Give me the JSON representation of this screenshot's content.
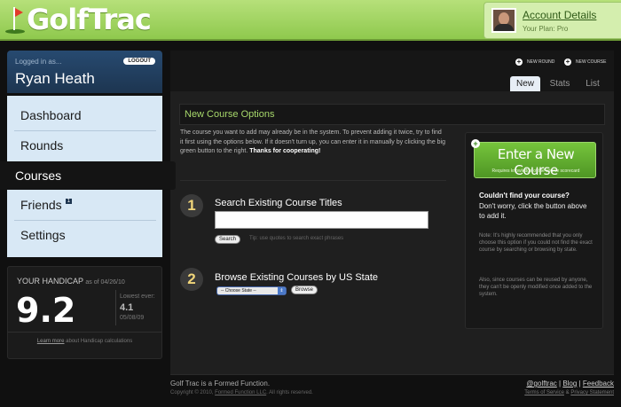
{
  "header": {
    "logo_text": "GolfTrac",
    "account_title": "Account Details",
    "plan": "Your Plan: Pro"
  },
  "user": {
    "logged_in_label": "Logged in as...",
    "logout_label": "LOGOUT",
    "name": "Ryan Heath"
  },
  "nav": {
    "items": [
      {
        "label": "Dashboard"
      },
      {
        "label": "Rounds"
      },
      {
        "label": "Courses"
      },
      {
        "label": "Friends",
        "badge": "1"
      },
      {
        "label": "Settings"
      }
    ]
  },
  "handicap": {
    "label": "YOUR HANDICAP",
    "as_of": "as of 04/26/10",
    "value": "9.2",
    "lowest_label": "Lowest ever:",
    "lowest_value": "4.1",
    "lowest_date": "05/08/09",
    "learn_link": "Learn more",
    "learn_rest": " about Handicap calculations"
  },
  "actions": {
    "new_round": "NEW ROUND",
    "new_course": "NEW COURSE"
  },
  "tabs": [
    {
      "label": "New",
      "active": true
    },
    {
      "label": "Stats"
    },
    {
      "label": "List"
    }
  ],
  "main": {
    "section_title": "New Course Options",
    "intro": "The course you want to add may already be in the system. To prevent adding it twice, try to find it first using the options below. If it doesn't turn up, you can enter it in manually by clicking the big green button to the right.",
    "intro_bold": "Thanks for cooperating!",
    "step1_num": "1",
    "step1_title": "Search Existing Course Titles",
    "search_value": "",
    "search_button": "Search",
    "tip": "Tip: use quotes to search exact phrases",
    "step2_num": "2",
    "step2_title": "Browse Existing Courses by US State",
    "state_selected": "-- Choose State --",
    "browse_button": "Browse"
  },
  "right_panel": {
    "button_title": "Enter a New Course",
    "button_sub": "Requires knowledge of the course scorecard",
    "question": "Couldn't find your course?",
    "answer": "Don't worry, click the button above to add it.",
    "note1": "Note: It's highly recommended that you only choose this option if you could not find the exact course by searching or browsing by state.",
    "note2": "Also, since courses can be reused by anyone, they can't be openly modified once added to the system."
  },
  "footer": {
    "tagline": "Golf Trac is a Formed Function.",
    "copyright_pre": "Copyright © 2010,",
    "copyright_link": "Formed Function LLC",
    "copyright_post": ". All rights reserved.",
    "links": [
      "@golftrac",
      "Blog",
      "Feedback"
    ],
    "legal": [
      "Terms of Service",
      "Privacy Statement"
    ]
  }
}
